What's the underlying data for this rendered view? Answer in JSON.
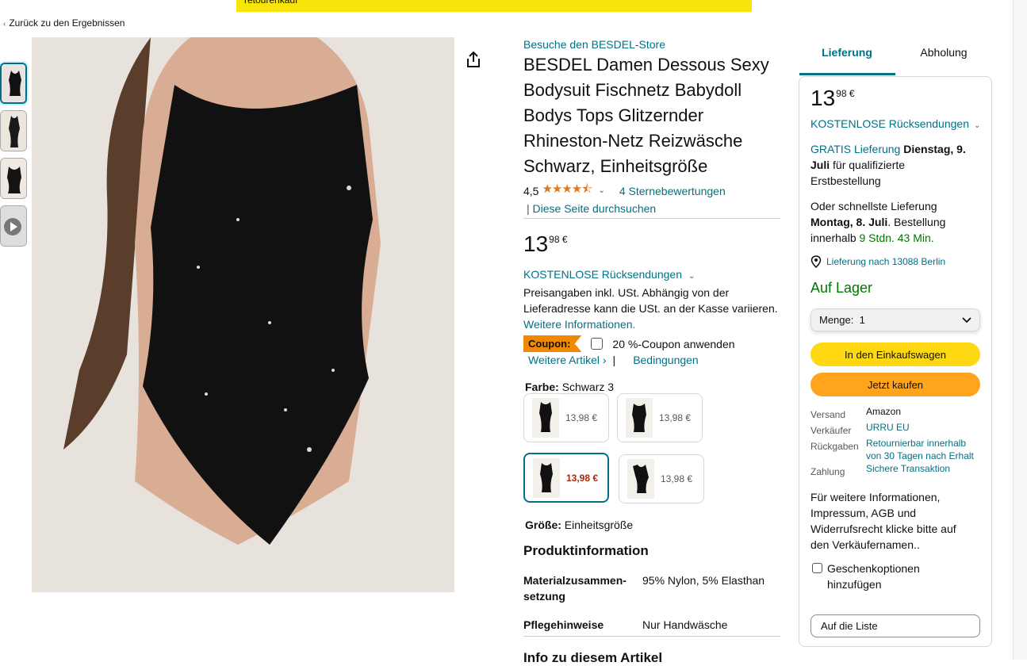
{
  "banner": {
    "text": "retourenkauf"
  },
  "nav": {
    "back_label": "Zurück zu den Ergebnissen"
  },
  "product": {
    "store_link": "Besuche den BESDEL-Store",
    "title": "BESDEL Damen Dessous Sexy Bodysuit Fischnetz Babydoll Bodys Tops Glitzernder Rhineston-Netz Reizwäsche Schwarz, Einheitsgröße",
    "rating": "4,5",
    "stars": "★★★★⯪",
    "rating_count": "4 Sternebewertungen",
    "search_page": "Diese Seite durchsuchen",
    "price_whole": "13",
    "price_fraction": "98 €",
    "free_returns": "KOSTENLOSE Rücksendungen",
    "tax_note": "Preisangaben inkl. USt. Abhängig von der Lieferadresse kann die USt. an der Kasse variieren.",
    "more_info": "Weitere Informationen.",
    "coupon_badge": "Coupon:",
    "coupon_apply": "20 %-Coupon anwenden",
    "coupon_more": "Weitere Artikel ›",
    "coupon_terms": "Bedingungen",
    "color_label": "Farbe:",
    "color_value": "Schwarz 3",
    "swatches": [
      {
        "price": "13,98 €"
      },
      {
        "price": "13,98 €"
      },
      {
        "price": "13,98 €"
      },
      {
        "price": "13,98 €"
      }
    ],
    "size_label": "Größe:",
    "size_value": "Einheitsgröße",
    "info_heading": "Produktinformation",
    "info_rows": [
      {
        "key": "Materialzusammen-setzung",
        "value": "95% Nylon, 5% Elasthan"
      },
      {
        "key": "Pflegehinweise",
        "value": "Nur Handwäsche"
      }
    ],
    "next_heading": "Info zu diesem Artikel"
  },
  "buybox": {
    "tab_delivery": "Lieferung",
    "tab_pickup": "Abholung",
    "price_whole": "13",
    "price_fraction": "98 €",
    "free_returns": "KOSTENLOSE Rücksendungen",
    "free_delivery": "GRATIS Lieferung",
    "delivery_date": "Dienstag, 9. Juli",
    "delivery_suffix": "für qualifizierte Erstbestellung",
    "fast_prefix": "Oder schnellste Lieferung",
    "fast_date": "Montag, 8. Juli",
    "fast_order": ". Bestellung innerhalb",
    "fast_countdown": "9 Stdn. 43 Min.",
    "location": "Lieferung nach 13088 Berlin",
    "stock": "Auf Lager",
    "qty_label": "Menge:",
    "qty_value": "1",
    "add_to_cart": "In den Einkaufswagen",
    "buy_now": "Jetzt kaufen",
    "details": [
      {
        "label": "Versand",
        "value": "Amazon"
      },
      {
        "label": "Verkäufer",
        "value": "URRU EU"
      },
      {
        "label": "Rückgaben",
        "value": "Retournierbar innerhalb von 30 Tagen nach Erhalt"
      },
      {
        "label": "Zahlung",
        "value": "Sichere Transaktion"
      }
    ],
    "seller_note": "Für weitere Informationen, Impressum, AGB und Widerrufsrecht klicke bitte auf den Verkäufernamen..",
    "gift": "Geschenkoptionen hinzufügen",
    "list_button": "Auf die Liste"
  },
  "colors": {
    "link": "#007185",
    "stock": "#007600",
    "cart": "#ffd814",
    "buy": "#ffa41c",
    "coupon": "#f08804",
    "price_red": "#b12704"
  }
}
